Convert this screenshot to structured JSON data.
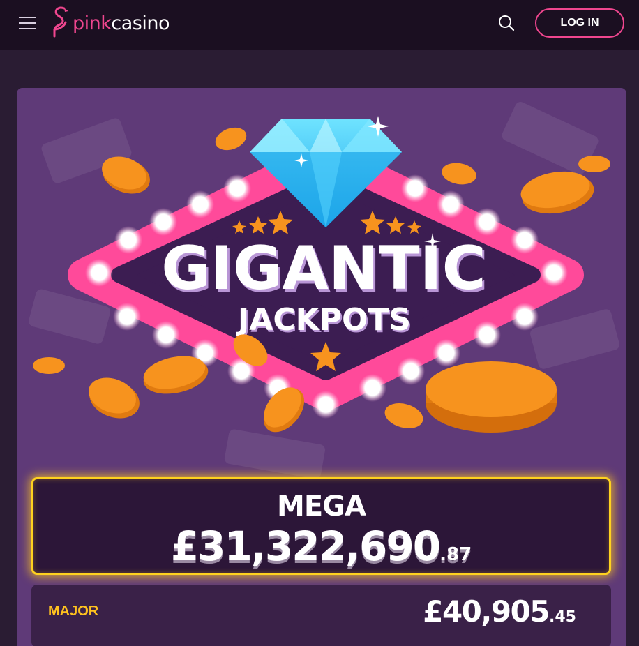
{
  "header": {
    "logo_left": "pink",
    "logo_right": "casino",
    "login_label": "LOG IN",
    "icons": [
      "menu-icon",
      "flamingo-logo-icon",
      "search-icon"
    ]
  },
  "banner": {
    "title_line1": "GIGANTIC",
    "title_line2": "JACKPOTS"
  },
  "jackpots": {
    "mega": {
      "label": "MEGA",
      "amount_main": "£31,322,690",
      "amount_cents": ".87"
    },
    "major": {
      "label": "MAJOR",
      "amount_main": "£40,905",
      "amount_cents": ".45"
    }
  },
  "colors": {
    "brand_pink": "#f0468f",
    "header_bg": "#1b0f21",
    "panel_bg": "#5f3a78",
    "gold": "#ffd21f",
    "diamond": "#3cc8f5",
    "coin": "#f7931e"
  }
}
